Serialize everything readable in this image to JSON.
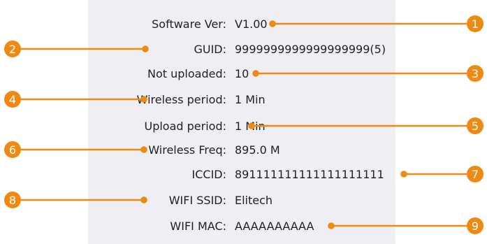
{
  "rows": [
    {
      "label": "Software Ver:",
      "value": "V1.00"
    },
    {
      "label": "GUID:",
      "value": "9999999999999999999(5)"
    },
    {
      "label": "Not uploaded:",
      "value": "10"
    },
    {
      "label": "Wireless period:",
      "value": "1 Min"
    },
    {
      "label": "Upload period:",
      "value": "1 Min"
    },
    {
      "label": "Wireless Freq:",
      "value": "895.0 M"
    },
    {
      "label": "ICCID:",
      "value": "891111111111111111111"
    },
    {
      "label": "WIFI SSID:",
      "value": "Elitech"
    },
    {
      "label": "WIFI MAC:",
      "value": "AAAAAAAAAA"
    }
  ],
  "callouts": [
    "1",
    "2",
    "3",
    "4",
    "5",
    "6",
    "7",
    "8",
    "9"
  ],
  "colors": {
    "accent": "#ee8a12",
    "panel": "#efeef3",
    "text": "#222222"
  }
}
